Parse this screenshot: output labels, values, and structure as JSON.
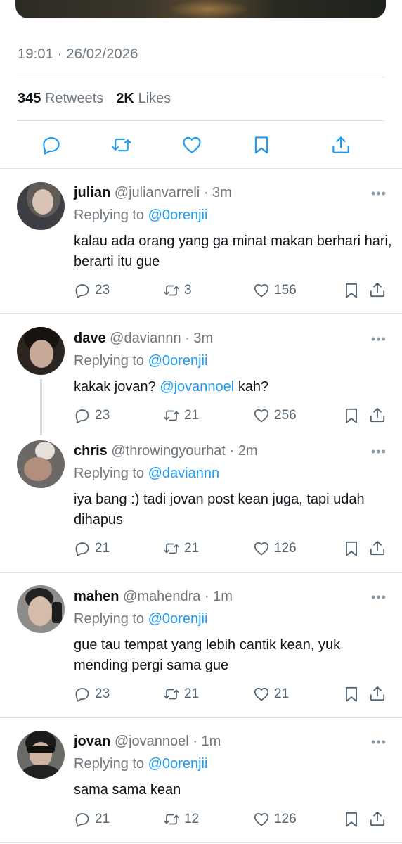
{
  "tweet": {
    "timestamp": "19:01 · 26/02/2026",
    "retweets_count": "345",
    "retweets_label": "Retweets",
    "likes_count": "2K",
    "likes_label": "Likes"
  },
  "actions": [
    "reply-icon",
    "retweet-icon",
    "like-icon",
    "bookmark-icon",
    "share-icon"
  ],
  "replies": [
    {
      "name": "julian",
      "handle": "@julianvarreli",
      "time": "· 3m",
      "replying_prefix": "Replying to",
      "replying_to": "@0orenjii",
      "text": "kalau ada orang yang ga minat makan berhari hari, berarti itu gue",
      "reply_count": "23",
      "retweet_count": "3",
      "like_count": "156"
    },
    {
      "name": "dave",
      "handle": "@daviannn",
      "time": "· 3m",
      "replying_prefix": "Replying to",
      "replying_to": "@0orenjii",
      "text_before": "kakak jovan?",
      "text_mention": "@jovannoel",
      "text_after": "kah?",
      "reply_count": "23",
      "retweet_count": "21",
      "like_count": "256"
    },
    {
      "name": "chris",
      "handle": "@throwingyourhat",
      "time": "· 2m",
      "replying_prefix": "Replying to",
      "replying_to": "@daviannn",
      "text": "iya bang :) tadi jovan post kean juga, tapi udah dihapus",
      "reply_count": "21",
      "retweet_count": "21",
      "like_count": "126"
    },
    {
      "name": "mahen",
      "handle": "@mahendra",
      "time": "· 1m",
      "replying_prefix": "Replying to",
      "replying_to": "@0orenjii",
      "text": "gue tau tempat yang lebih cantik kean, yuk mending pergi sama gue",
      "reply_count": "23",
      "retweet_count": "21",
      "like_count": "21"
    },
    {
      "name": "jovan",
      "handle": "@jovannoel",
      "time": "· 1m",
      "replying_prefix": "Replying to",
      "replying_to": "@0orenjii",
      "text": "sama sama kean",
      "reply_count": "21",
      "retweet_count": "12",
      "like_count": "126"
    }
  ],
  "more_glyph": "•••",
  "colors": {
    "text": "#0f1419",
    "secondary": "#6e767d",
    "link": "#1d9bf0",
    "divider": "#e1e4e8",
    "thread_line": "#cfd9de"
  }
}
